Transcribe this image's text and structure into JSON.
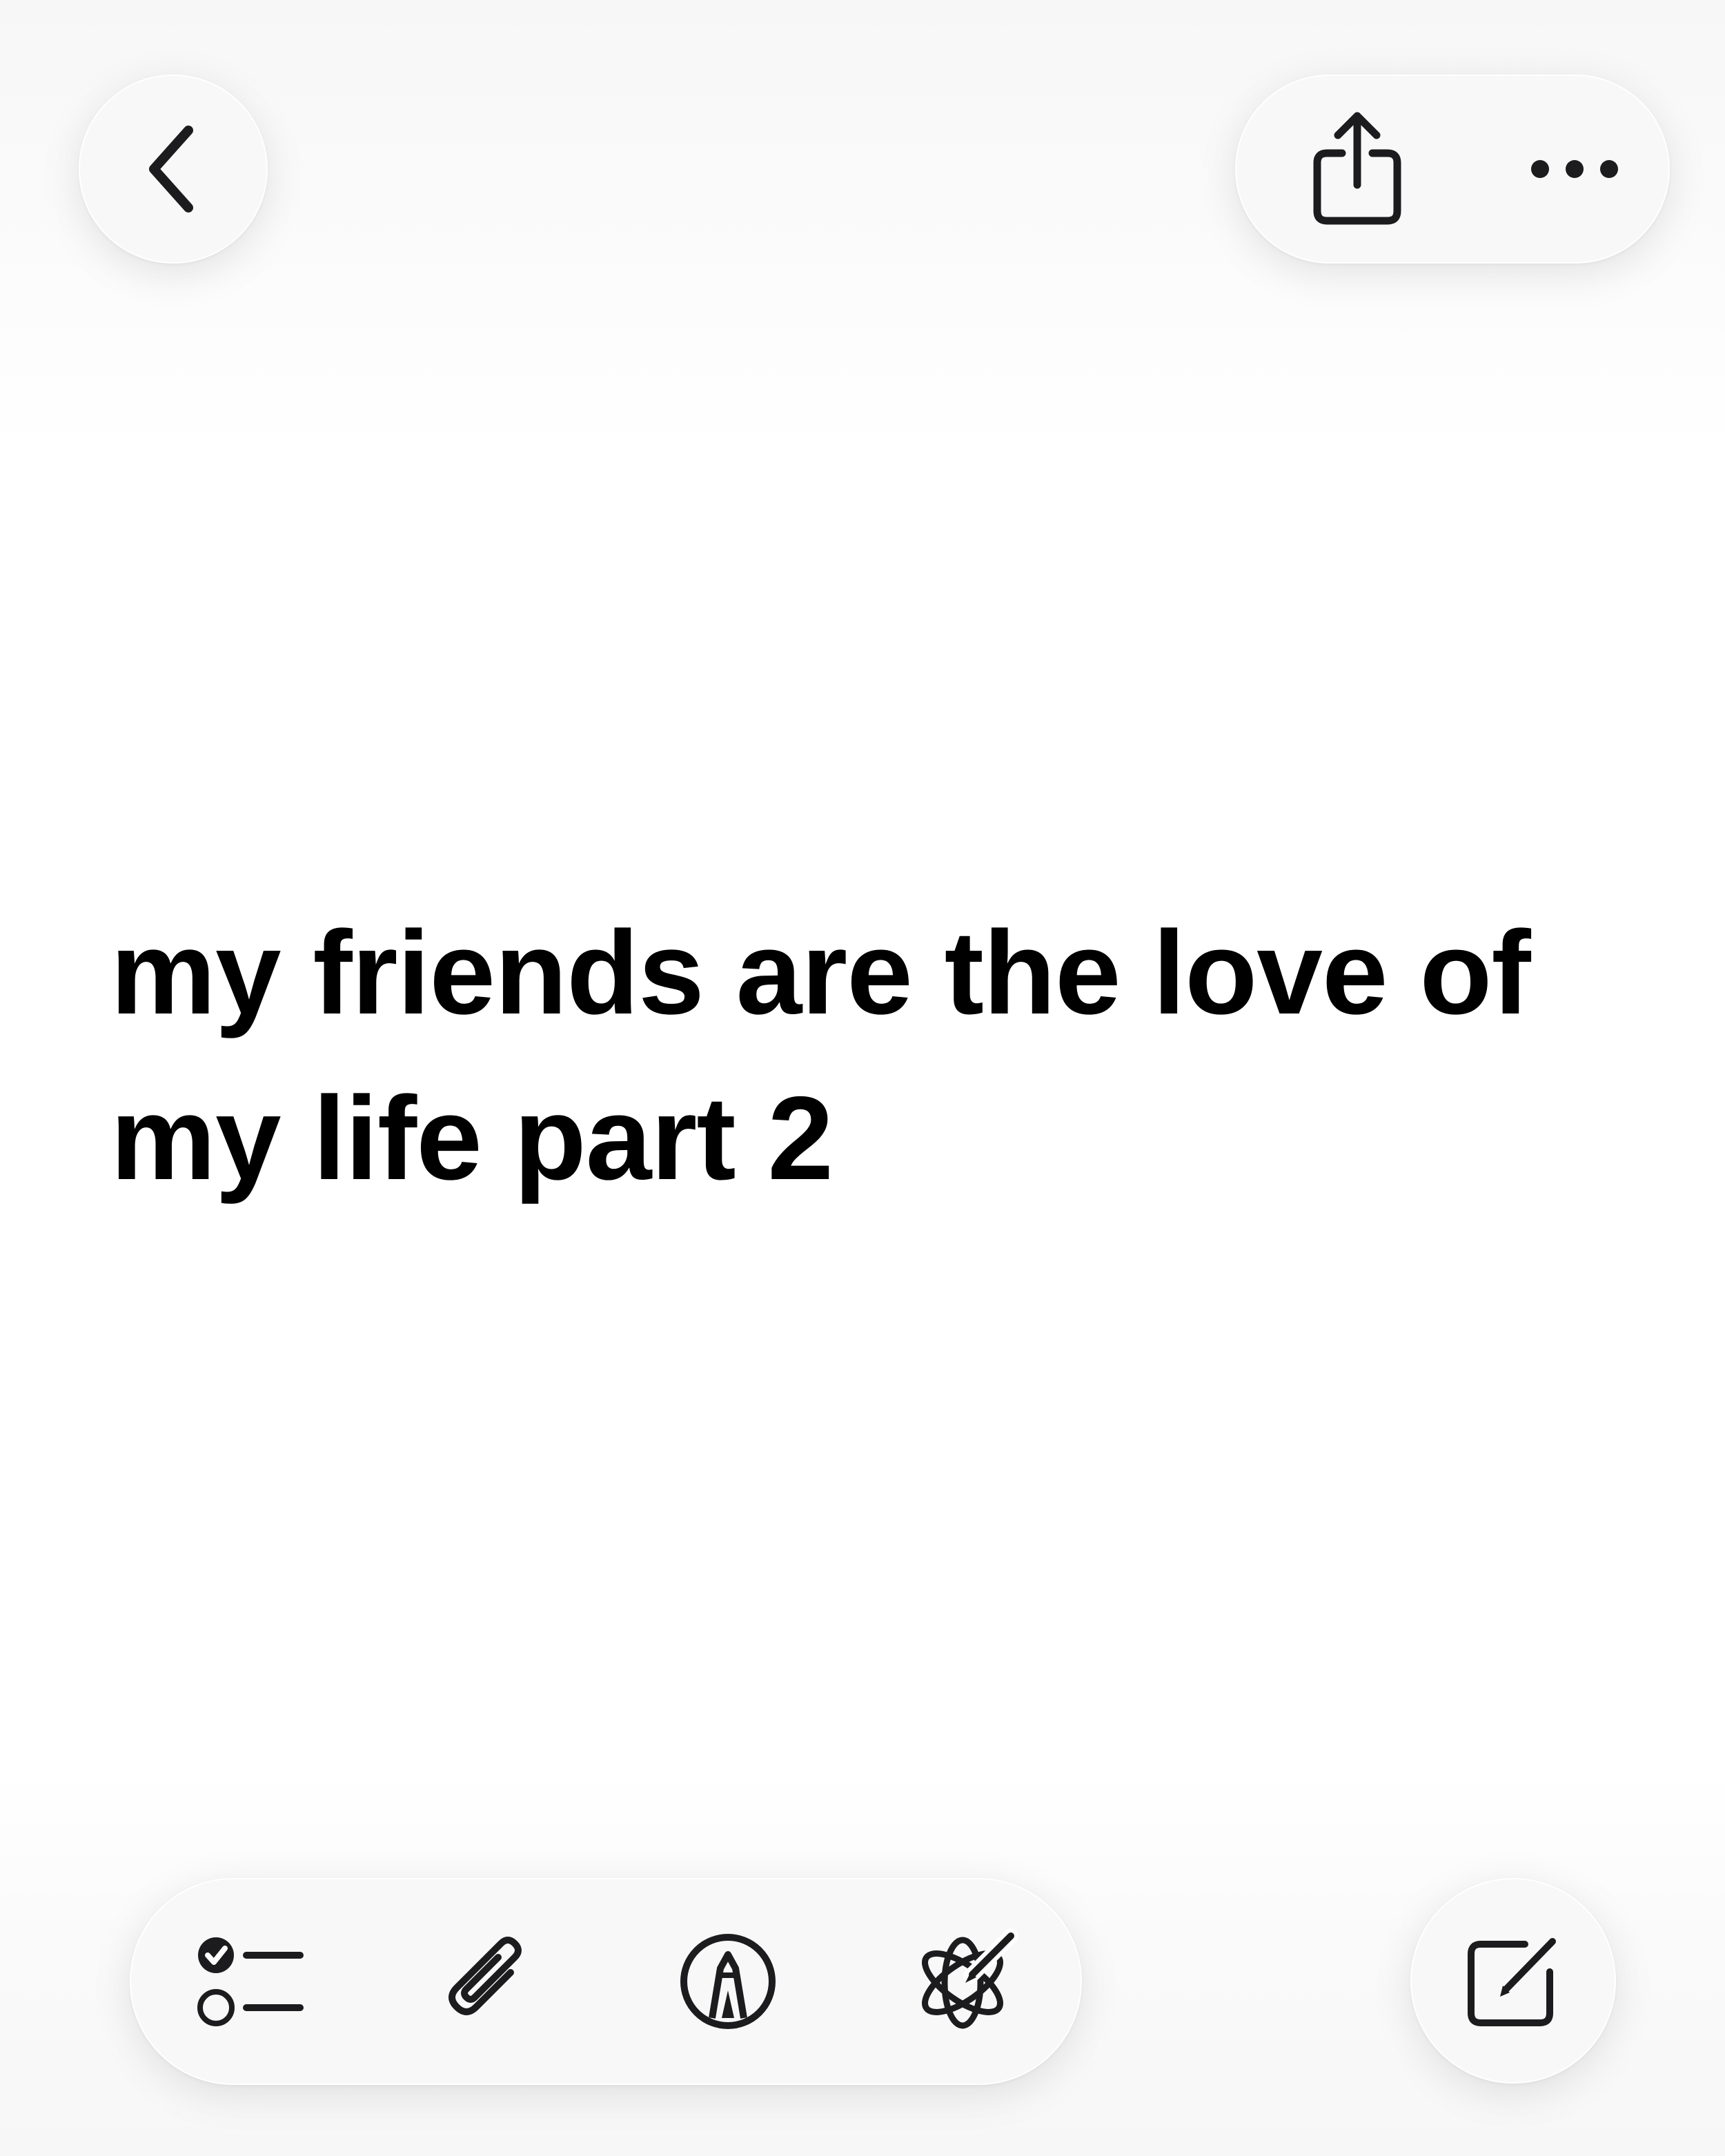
{
  "toolbar_top": {
    "back_icon": "chevron-left-icon",
    "share_icon": "share-icon",
    "more_icon": "ellipsis-icon"
  },
  "note": {
    "title": "my friends are the love of my life part 2"
  },
  "toolbar_bottom": {
    "checklist_icon": "checklist-icon",
    "attachment_icon": "paperclip-icon",
    "markup_icon": "pen-tip-circle-icon",
    "writing_tools_icon": "apple-intelligence-icon",
    "compose_icon": "compose-icon"
  },
  "colors": {
    "background": "#ffffff",
    "control_fill": "#f8f8f8",
    "icon": "#1c1c1e",
    "text": "#000000"
  }
}
